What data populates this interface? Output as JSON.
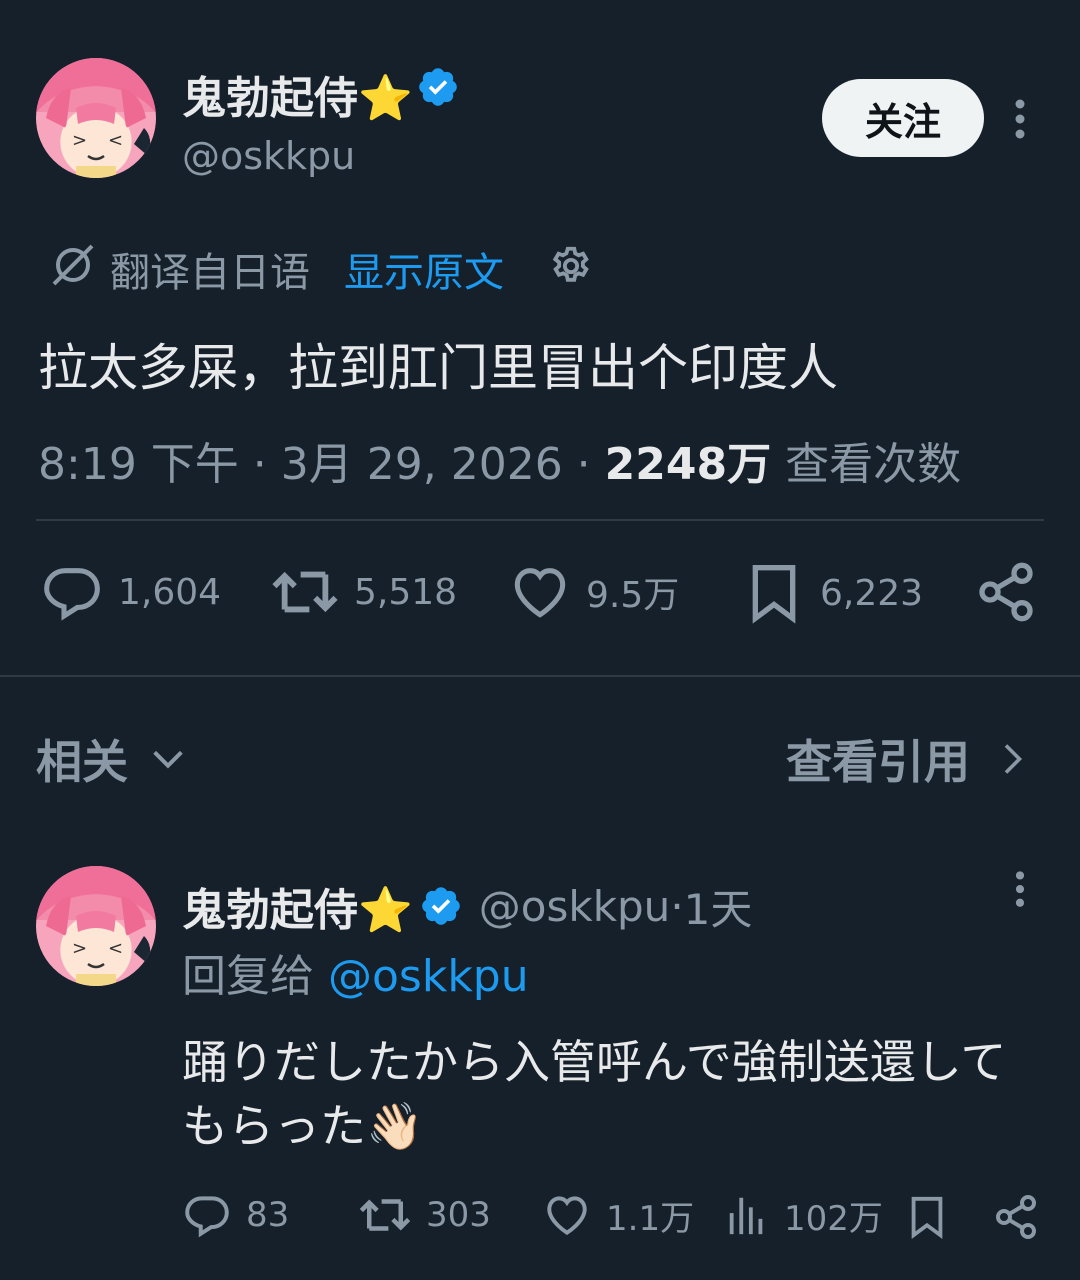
{
  "main_post": {
    "author_name": "鬼勃起侍⭐",
    "author_handle": "@oskkpu",
    "follow_label": "关注",
    "translation_source": "翻译自日语",
    "show_original_label": "显示原文",
    "text": "拉太多屎，拉到肛门里冒出个印度人",
    "time": "8:19 下午",
    "date": "3月 29, 2026",
    "views_count": "2248万",
    "views_label": "查看次数",
    "actions": {
      "replies": "1,604",
      "reposts": "5,518",
      "likes": "9.5万",
      "bookmarks": "6,223"
    }
  },
  "related_bar": {
    "related_label": "相关",
    "view_quotes_label": "查看引用"
  },
  "reply_post": {
    "author_name": "鬼勃起侍⭐",
    "author_handle": "@oskkpu",
    "time_ago": "1天",
    "reply_prefix": "回复给",
    "reply_to": "@oskkpu",
    "text": "踊りだしたから入管呼んで強制送還してもらった👋🏻",
    "actions": {
      "replies": "83",
      "reposts": "303",
      "likes": "1.1万",
      "views": "102万"
    }
  },
  "icons": {
    "verified": "verified-badge-icon",
    "translate": "translate-icon",
    "settings": "gear-icon",
    "reply": "speech-bubble-icon",
    "repost": "repost-icon",
    "like": "heart-icon",
    "bookmark": "bookmark-icon",
    "share": "share-icon",
    "views": "bar-chart-icon",
    "more": "more-vertical-icon",
    "chevron_down": "chevron-down-icon",
    "chevron_right": "chevron-right-icon"
  },
  "colors": {
    "background": "#15202b",
    "text": "#e7e9ea",
    "muted": "#8b98a5",
    "accent": "#1d9bf0"
  }
}
